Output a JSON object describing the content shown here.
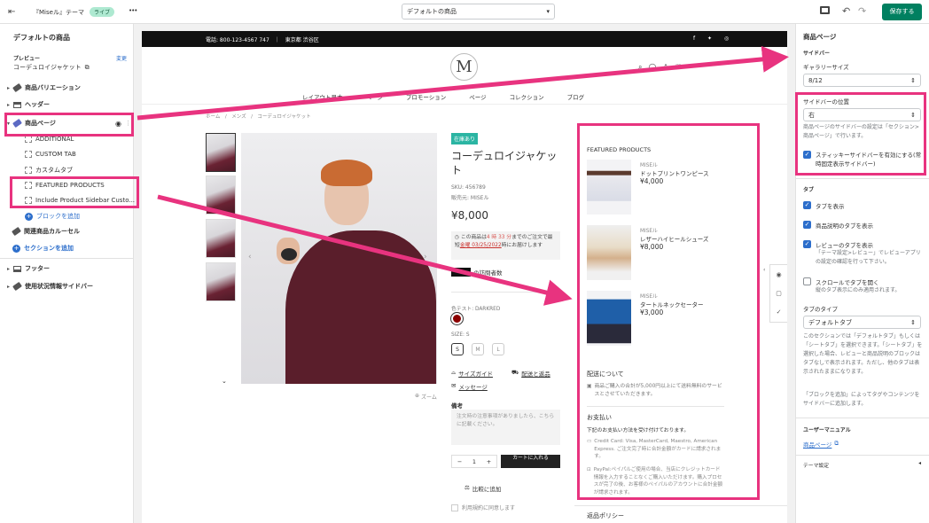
{
  "topbar": {
    "theme_name": "『Miseル』テーマ",
    "live_badge": "ライブ",
    "more": "•••",
    "template_select": "デフォルトの商品",
    "save": "保存する"
  },
  "left": {
    "title": "デフォルトの商品",
    "preview_label": "プレビュー",
    "preview_change": "変更",
    "preview_value": "コーデュロイジャケット",
    "items": {
      "variation": "商品バリエーション",
      "header": "ヘッダー",
      "product_page": "商品ページ",
      "additional": "ADDITIONAL",
      "custom_tab": "CUSTOM TAB",
      "custom_tab_jp": "カスタムタブ",
      "featured": "FEATURED PRODUCTS",
      "include_sidebar": "Include Product Sidebar Custo...",
      "add_block": "ブロックを追加",
      "related": "関連商品カルーセル",
      "add_section": "セクションを追加",
      "footer": "フッター",
      "usage_sidebar": "使用状況情報サイドバー"
    }
  },
  "store": {
    "announcement": "電話: 800-123-4567 747　｜　東京都 渋谷区",
    "logo": "M",
    "nav": [
      "レイアウト見本",
      "ページ",
      "プロモーション",
      "ページ",
      "コレクション",
      "ブログ"
    ],
    "breadcrumb": "ホーム　/　メンズ　/　コーデュロイジャケット",
    "stock_badge": "在庫あり",
    "title": "コーデュロイジャケット",
    "sku": "SKU: 456789",
    "vendor": "販売元: MISEル",
    "price": "¥8,000",
    "timer_pre": "この商品は",
    "timer_time": "4 時 33 分",
    "timer_mid": "までのご注文で最短",
    "timer_date": "金曜 03/25/2022",
    "timer_post": "時にお届けします",
    "visitors": "の訪問者数",
    "color_label": "色テスト: DARKRED",
    "size_label": "SIZE: S",
    "sizes": [
      "S",
      "M",
      "L"
    ],
    "size_guide": "サイズガイド",
    "shipping_returns": "配送と返品",
    "message": "メッセージ",
    "note_label": "備考",
    "note_placeholder": "注文時の注意事項がありましたら、こちらに記載ください。",
    "qty": "1",
    "add_to_cart": "カートに入れる",
    "compare": "比較に追加",
    "terms": "利用規約に同意します",
    "zoom": "ズーム"
  },
  "sidebar_widget": {
    "featured_title": "FEATURED PRODUCTS",
    "products": [
      {
        "vendor": "MISEル",
        "name": "ドットプリントワンピース",
        "price": "¥4,000"
      },
      {
        "vendor": "MISEル",
        "name": "レザーハイヒールシューズ",
        "price": "¥8,000"
      },
      {
        "vendor": "MISEル",
        "name": "タートルネックセーター",
        "price": "¥3,000"
      }
    ],
    "shipping_title": "配送について",
    "shipping_text": "商品ご購入の合計が5,000円以上にて送料無料のサービスとさせていただきます。",
    "payment_title": "お支払い",
    "payment_intro": "下記のお支払い方法を受け付けております。",
    "payment_card": "Credit Card: Visa, MasterCard, Maestro, American Express. ご注文完了時に合計金額がカードに請求されます。",
    "payment_paypal": "PayPal:ペイパルご使用の場合、当店にクレジットカード情報を入力することなくご購入いただけます。購入プロセスが完了の後、お客様のペイパルのアカウントに合計金額が請求されます。",
    "returns_title": "返品ポリシー"
  },
  "right": {
    "title": "商品ページ",
    "sidebar_heading": "サイドバー",
    "gallery_size_label": "ギャラリーサイズ",
    "gallery_size": "8/12",
    "sidebar_pos_label": "サイドバーの位置",
    "sidebar_pos": "右",
    "sidebar_help": "商品ページのサイドバーの設定は「セクション>商品ページ」で行います。",
    "sticky_label": "スティッキーサイドバーを有効にする(常時固定表示サイドバー)",
    "tabs_heading": "タブ",
    "show_tabs": "タブを表示",
    "desc_tab": "商品説明のタブを表示",
    "review_tab": "レビューのタブを表示",
    "review_help": "「テーマ設定>レビュー」でレビューアプリの設定の確認を行って下さい。",
    "scroll_tab": "スクロールでタブを開く",
    "scroll_help": "縦のタブ表示にのみ適用されます。",
    "tab_type_label": "タブのタイプ",
    "tab_type": "デフォルトタブ",
    "tab_type_help": "このセクションでは「デフォルトタブ」もしくは「シートタブ」を選択できます。「シートタブ」を選択した場合、レビューと商品説明のブロックはタブなしで表示されます。ただし、他のタブは表示されたままになります。",
    "block_help": "「ブロックを追加」によってタグやコンテンツをサイドバーに追加します。",
    "manual_heading": "ユーザーマニュアル",
    "manual_link": "商品ページ",
    "theme_settings": "テーマ設定"
  },
  "colors": {
    "accent": "#e8337f",
    "primary": "#2c6ecb",
    "save": "#008060",
    "live": "#aee9d1"
  }
}
